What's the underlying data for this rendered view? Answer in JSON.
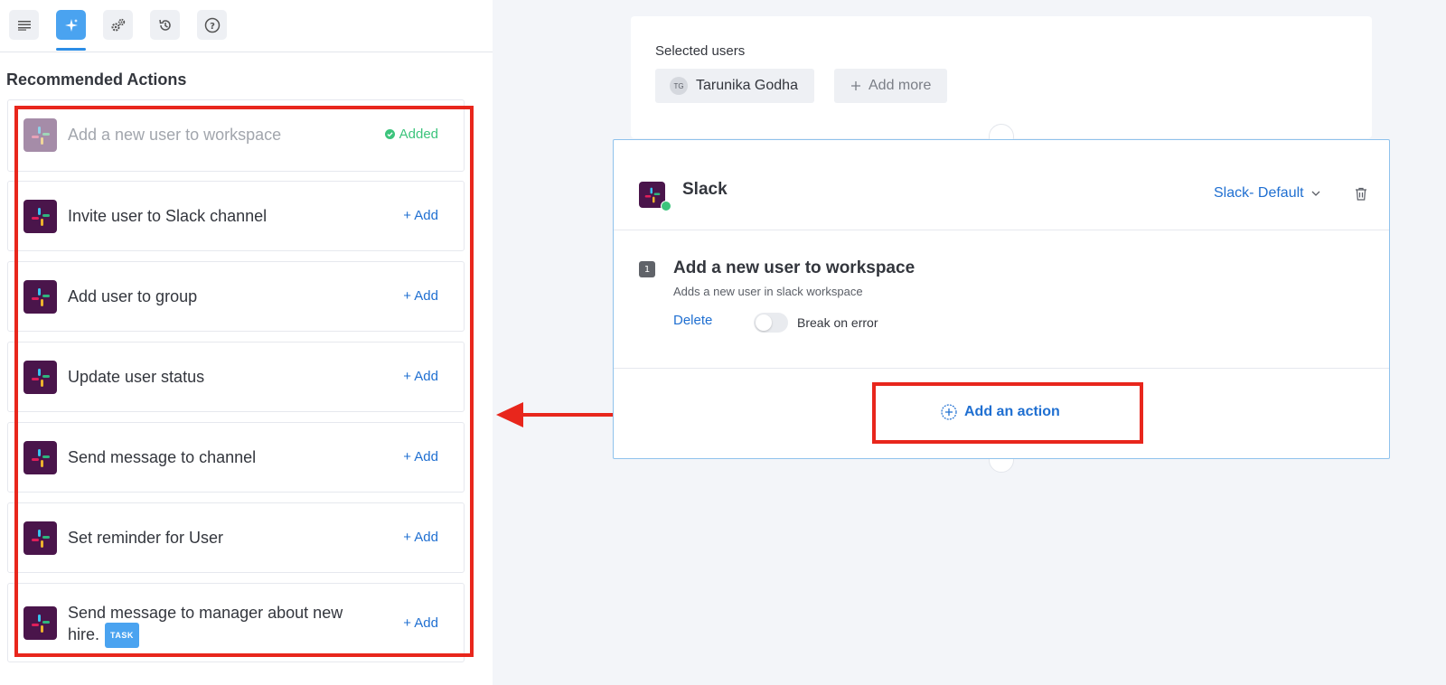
{
  "toolbar": {
    "icons": [
      "notes-icon",
      "sparkle-icon",
      "gears-icon",
      "history-icon",
      "help-icon"
    ]
  },
  "panel": {
    "title": "Recommended Actions"
  },
  "actions": [
    {
      "label": "Add a new user to workspace",
      "status": "Added",
      "state": "added"
    },
    {
      "label": "Invite user to Slack channel",
      "status": "+ Add",
      "state": "available"
    },
    {
      "label": "Add user to group",
      "status": "+ Add",
      "state": "available"
    },
    {
      "label": "Update user status",
      "status": "+ Add",
      "state": "available"
    },
    {
      "label": "Send message to channel",
      "status": "+ Add",
      "state": "available"
    },
    {
      "label": "Set reminder for User",
      "status": "+ Add",
      "state": "available"
    },
    {
      "label_line1": "Send message to manager about new",
      "label_line2": "hire.",
      "badge": "TASK",
      "status": "+ Add",
      "state": "available"
    }
  ],
  "users": {
    "title": "Selected users",
    "chip_initials": "TG",
    "chip_name": "Tarunika Godha",
    "add_more": "Add more"
  },
  "slack": {
    "name": "Slack",
    "connection": "Slack- Default",
    "step": {
      "number": "1",
      "title": "Add a new user to workspace",
      "description": "Adds a new user in slack workspace",
      "delete_label": "Delete",
      "toggle_label": "Break on error",
      "toggle_on": false
    },
    "add_action_label": "Add an action"
  },
  "colors": {
    "accent": "#1f6fd1",
    "annotation": "#e8261c",
    "slack_bg": "#4a154b",
    "added_green": "#3cc47c"
  }
}
